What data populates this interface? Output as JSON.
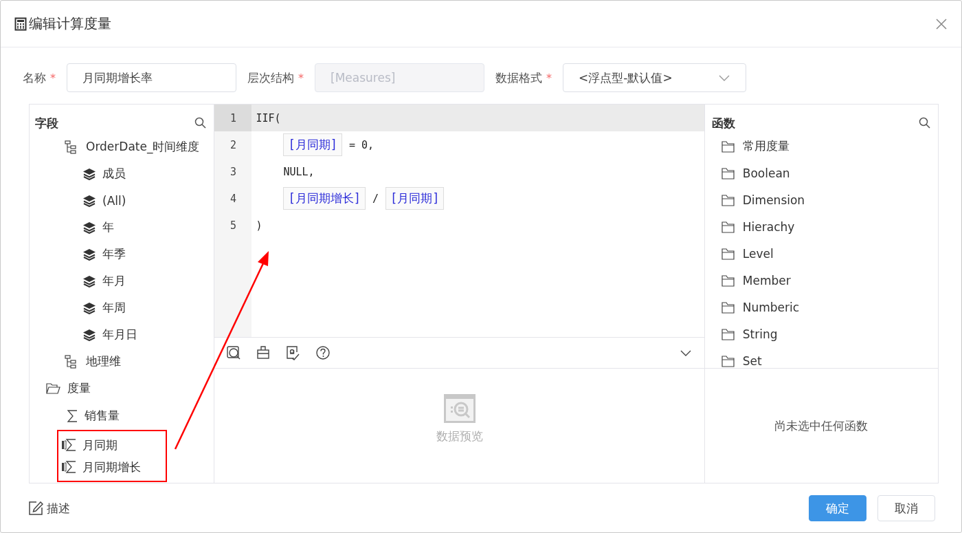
{
  "dialog": {
    "title": "编辑计算度量"
  },
  "form": [
    {
      "label": "名称",
      "required_mark": "*",
      "kind": "input",
      "value": "月同期增长率",
      "disabled": false
    },
    {
      "label": "层次结构",
      "required_mark": "*",
      "kind": "input",
      "value": "[Measures]",
      "disabled": true
    },
    {
      "label": "数据格式",
      "required_mark": "*",
      "kind": "select",
      "value": "<浮点型-默认值>"
    }
  ],
  "fields": {
    "title": "字段",
    "items": [
      {
        "kind": "hierarchy",
        "label": "OrderDate_时间维度",
        "children": [
          {
            "kind": "level",
            "label": "成员"
          },
          {
            "kind": "level",
            "label": "(All)"
          },
          {
            "kind": "level",
            "label": "年"
          },
          {
            "kind": "level",
            "label": "年季"
          },
          {
            "kind": "level",
            "label": "年月"
          },
          {
            "kind": "level",
            "label": "年周"
          },
          {
            "kind": "level",
            "label": "年月日"
          }
        ]
      },
      {
        "kind": "hierarchy",
        "label": "地理维"
      },
      {
        "kind": "folder",
        "label": "度量",
        "children": [
          {
            "kind": "measure",
            "label": "销售量",
            "highlighted": false
          },
          {
            "kind": "calc_measure",
            "label": "月同期",
            "highlighted": true
          },
          {
            "kind": "calc_measure",
            "label": "月同期增长",
            "highlighted": true
          }
        ]
      }
    ]
  },
  "editor": {
    "lines": [
      {
        "number": "1",
        "active": true,
        "indented": false,
        "tokens": [
          {
            "kind": "text",
            "text": "IIF("
          }
        ]
      },
      {
        "number": "2",
        "active": false,
        "indented": true,
        "tokens": [
          {
            "kind": "field",
            "text": "[月同期]"
          },
          {
            "kind": "text",
            "text": "= 0,"
          }
        ]
      },
      {
        "number": "3",
        "active": false,
        "indented": true,
        "tokens": [
          {
            "kind": "text",
            "text": "NULL,"
          }
        ]
      },
      {
        "number": "4",
        "active": false,
        "indented": true,
        "tokens": [
          {
            "kind": "field",
            "text": "[月同期增长]"
          },
          {
            "kind": "text",
            "text": "/"
          },
          {
            "kind": "field",
            "text": "[月同期]"
          }
        ]
      },
      {
        "number": "5",
        "active": false,
        "indented": false,
        "tokens": [
          {
            "kind": "text",
            "text": ")"
          }
        ]
      }
    ],
    "preview": {
      "label": "数据预览"
    }
  },
  "functions": {
    "title": "函数",
    "items": [
      {
        "label": "常用度量"
      },
      {
        "label": "Boolean"
      },
      {
        "label": "Dimension"
      },
      {
        "label": "Hierachy"
      },
      {
        "label": "Level"
      },
      {
        "label": "Member"
      },
      {
        "label": "Numberic"
      },
      {
        "label": "String"
      },
      {
        "label": "Set"
      }
    ],
    "empty_message": "尚未选中任何函数"
  },
  "footer": {
    "describe": "描述",
    "buttons": [
      {
        "label": "确定",
        "kind": "primary"
      },
      {
        "label": "取消",
        "kind": "default"
      }
    ]
  }
}
